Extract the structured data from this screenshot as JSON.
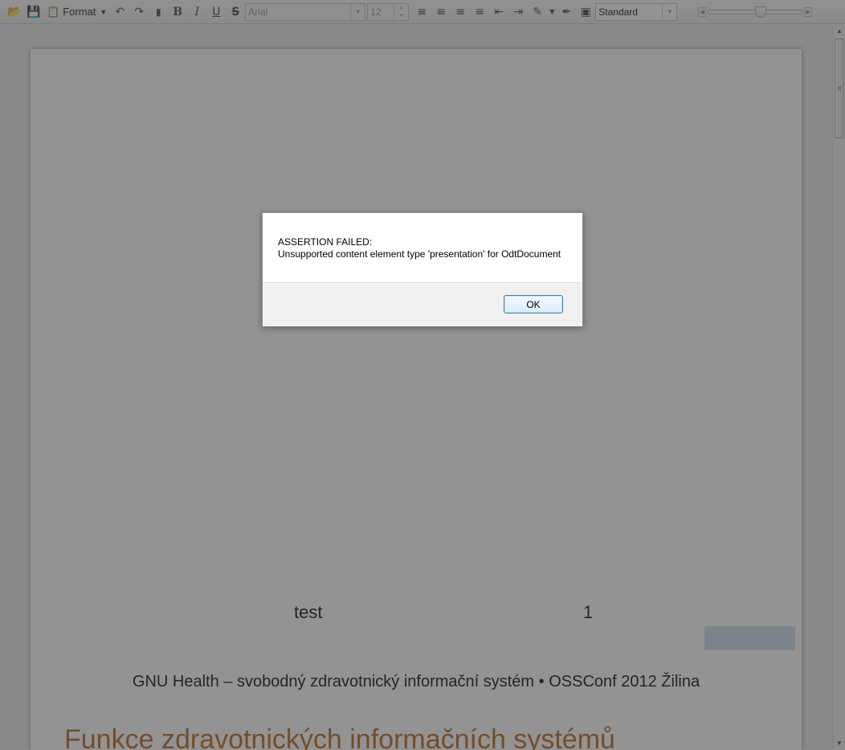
{
  "toolbar": {
    "format_label": "Format",
    "font_name": "Arial",
    "font_size": "12",
    "paragraph_style": "Standard"
  },
  "document": {
    "footer_left": "test",
    "page_number": "1",
    "subtitle": "GNU Health – svobodný zdravotnický informační systém  •  OSSConf 2012 Žilina",
    "heading": "Funkce zdravotnických informačních systémů"
  },
  "dialog": {
    "line1": "ASSERTION FAILED:",
    "line2": "Unsupported content element type 'presentation' for OdtDocument",
    "ok_label": "OK"
  },
  "colors": {
    "heading": "#c0732a",
    "overlay": "#282828",
    "ok_border": "#3c7fb1"
  }
}
